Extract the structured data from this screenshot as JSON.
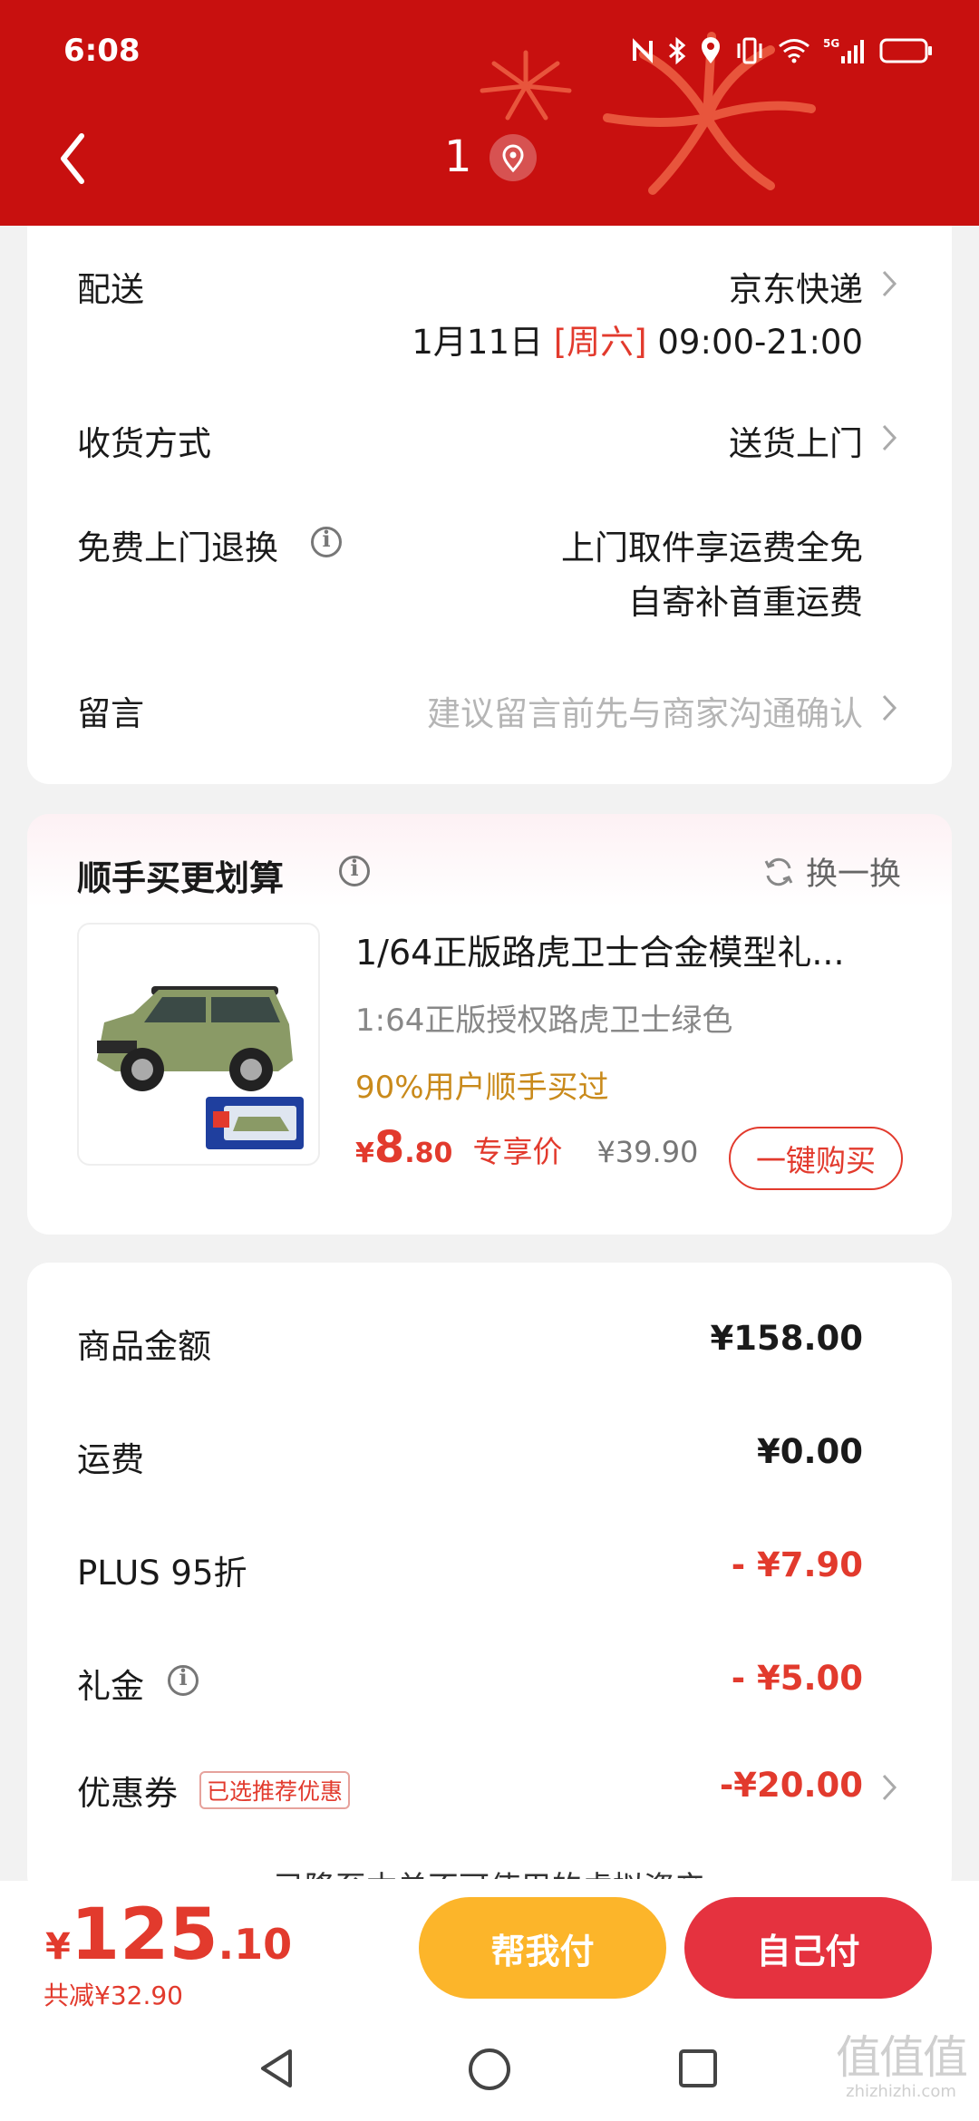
{
  "status_bar": {
    "time": "6:08"
  },
  "header": {
    "title": "1"
  },
  "delivery": {
    "label": "配送",
    "carrier": "京东快递",
    "date": "1月11日",
    "weekday": "[周六]",
    "time_slot": "09:00-21:00"
  },
  "receive": {
    "label": "收货方式",
    "value": "送货上门"
  },
  "free_return": {
    "label": "免费上门退换",
    "line1": "上门取件享运费全免",
    "line2": "自寄补首重运费"
  },
  "message": {
    "label": "留言",
    "placeholder": "建议留言前先与商家沟通确认"
  },
  "addon": {
    "title": "顺手买更划算",
    "swap_label": "换一换",
    "product": {
      "title": "1/64正版路虎卫士合金模型礼...",
      "spec": "1:64正版授权路虎卫士绿色",
      "stat": "90%用户顺手买过",
      "price_symbol": "¥",
      "price_int": "8",
      "price_dec": ".80",
      "price_tag": "专享价",
      "original_price": "¥39.90",
      "buy_label": "一键购买"
    }
  },
  "summary": {
    "goods": {
      "label": "商品金额",
      "value": "¥158.00"
    },
    "shipping": {
      "label": "运费",
      "value": "¥0.00"
    },
    "plus": {
      "label": "PLUS 95折",
      "value": "- ¥7.90"
    },
    "gift": {
      "label": "礼金",
      "value": "- ¥5.00"
    },
    "coupon": {
      "label": "优惠券",
      "tag": "已选推荐优惠",
      "value": "-¥20.00"
    },
    "cut_text": "已降至本单不可使用的虚拟资产"
  },
  "bottom": {
    "total_symbol": "¥",
    "total_int": "125",
    "total_dec": ".10",
    "saved": "共减¥32.90",
    "help_pay": "帮我付",
    "self_pay": "自己付"
  },
  "watermark": {
    "main": "值值值",
    "url": "zhizhizhi.com"
  },
  "colors": {
    "header_red": "#c8100f",
    "accent_red": "#e23a2d",
    "help_yellow": "#fcb52a",
    "self_red": "#e5323f",
    "stat_gold": "#c98a1b"
  }
}
